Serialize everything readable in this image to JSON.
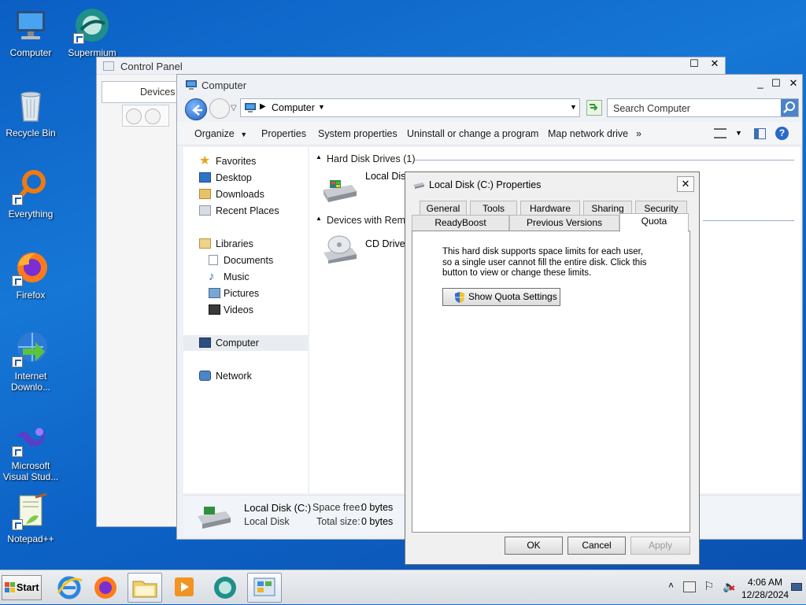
{
  "desktop": {
    "icons": [
      {
        "label": "Computer",
        "icon": "computer-icon"
      },
      {
        "label": "Supermium",
        "icon": "supermium-icon"
      },
      {
        "label": "Recycle Bin",
        "icon": "recycle-bin-icon"
      },
      {
        "label": "Everything",
        "icon": "everything-search-icon"
      },
      {
        "label": "Firefox",
        "icon": "firefox-icon"
      },
      {
        "label": "Internet Downlo...",
        "icon": "internet-download-manager-icon"
      },
      {
        "label": "Microsoft Visual Stud...",
        "icon": "visual-studio-icon"
      },
      {
        "label": "Notepad++",
        "icon": "notepad-plus-plus-icon"
      }
    ]
  },
  "control_panel": {
    "title": "Control Panel",
    "crumb": "Devices a"
  },
  "explorer": {
    "title": "Computer",
    "address_crumb": "Computer",
    "search_placeholder": "Search Computer",
    "toolbar": {
      "organize": "Organize",
      "properties": "Properties",
      "system_properties": "System properties",
      "uninstall": "Uninstall or change a program",
      "map_drive": "Map network drive",
      "more": "»"
    },
    "nav": {
      "favorites": "Favorites",
      "desktop": "Desktop",
      "downloads": "Downloads",
      "recent": "Recent Places",
      "libraries": "Libraries",
      "documents": "Documents",
      "music": "Music",
      "pictures": "Pictures",
      "videos": "Videos",
      "computer": "Computer",
      "network": "Network"
    },
    "groups": {
      "hdd": "Hard Disk Drives (1)",
      "removable": "Devices with Remo"
    },
    "items": {
      "local_disk": "Local Disk",
      "cd_drive": "CD Drive ("
    },
    "details": {
      "name": "Local Disk (C:)",
      "type": "Local Disk",
      "space_free_label": "Space free:",
      "space_free_value": "0 bytes",
      "total_size_label": "Total size:",
      "total_size_value": "0 bytes"
    }
  },
  "dialog": {
    "title": "Local Disk (C:) Properties",
    "tabs_row1": [
      "General",
      "Tools",
      "Hardware",
      "Sharing",
      "Security"
    ],
    "tabs_row2": [
      "ReadyBoost",
      "Previous Versions",
      "Quota"
    ],
    "active_tab": "Quota",
    "quota_text": "This hard disk supports space limits for each user, so a single user cannot fill the entire disk. Click this button to view or change these limits.",
    "show_quota_button": "Show Quota Settings",
    "ok": "OK",
    "cancel": "Cancel",
    "apply": "Apply"
  },
  "taskbar": {
    "start": "Start",
    "time": "4:06 AM",
    "date": "12/28/2024"
  }
}
